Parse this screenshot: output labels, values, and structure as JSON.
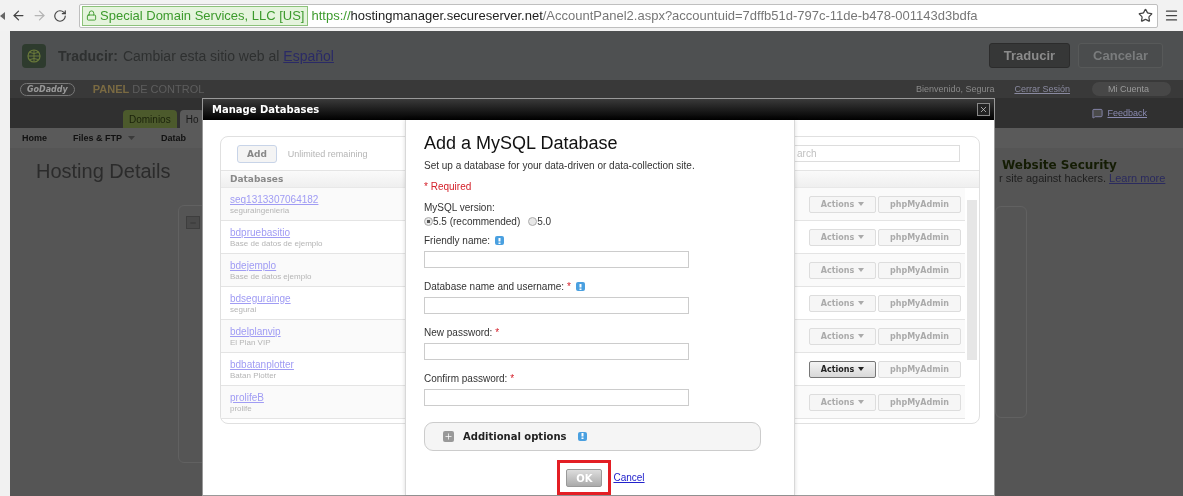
{
  "browser": {
    "security_label": "Special Domain Services, LLC [US]",
    "url_scheme": "https://",
    "url_host": "hostingmanager.secureserver.net",
    "url_path": "/AccountPanel2.aspx?accountuid=7dffb51d-797c-11de-b478-001143d3bdfa"
  },
  "translate_bar": {
    "label": "Traducir:",
    "text": "Cambiar esta sitio web al",
    "link": "Español",
    "buttons": [
      {
        "label": "Traducir",
        "disabled": false
      },
      {
        "label": "Cancelar",
        "disabled": true
      }
    ]
  },
  "header": {
    "logo": "GoDaddy",
    "title_accent": "PANEL",
    "title_rest": "DE CONTROL",
    "welcome": "Bienvenido, Segura",
    "logout": "Cerrar Sesión",
    "account": "Mi Cuenta",
    "feedback": "Feedback"
  },
  "tabs": [
    {
      "label": "Dominios",
      "selected": false
    },
    {
      "label": "Ho",
      "selected": true
    }
  ],
  "nav": [
    {
      "label": "Home",
      "dropdown": false
    },
    {
      "label": "Files & FTP",
      "dropdown": true
    },
    {
      "label": "Datab",
      "dropdown": false
    }
  ],
  "page": {
    "title": "Hosting Details",
    "promo_title": "Website Security",
    "promo_text": "r site against hackers.",
    "promo_link": "Learn more"
  },
  "modal": {
    "title": "Manage Databases",
    "add_button": "Add",
    "remaining": "Unlimited remaining",
    "search_placeholder": "arch",
    "list_header": "Databases",
    "databases": [
      {
        "name": "seq1313307064182",
        "description": "seguraingenieria",
        "actions": "Actions",
        "admin": "phpMyAdmin",
        "active": false
      },
      {
        "name": "bdpruebasitio",
        "description": "Base de datos de ejemplo",
        "actions": "Actions",
        "admin": "phpMyAdmin",
        "active": false
      },
      {
        "name": "bdejemplo",
        "description": "Base de datos ejemplo",
        "actions": "Actions",
        "admin": "phpMyAdmin",
        "active": false
      },
      {
        "name": "bdsegurainge",
        "description": "segurai",
        "actions": "Actions",
        "admin": "phpMyAdmin",
        "active": false
      },
      {
        "name": "bdelplanvip",
        "description": "El Plan VIP",
        "actions": "Actions",
        "admin": "phpMyAdmin",
        "active": false
      },
      {
        "name": "bdbatanplotter",
        "description": "Batan Plotter",
        "actions": "Actions",
        "admin": "phpMyAdmin",
        "active": true
      },
      {
        "name": "prolifeB",
        "description": "prolife",
        "actions": "Actions",
        "admin": "phpMyAdmin",
        "active": false
      }
    ]
  },
  "form": {
    "title": "Add a MySQL Database",
    "description": "Set up a database for your data-driven or data-collection site.",
    "required_note": "* Required",
    "version_label": "MySQL version:",
    "versions": [
      {
        "label": "5.5 (recommended)",
        "selected": true
      },
      {
        "label": "5.0",
        "selected": false
      }
    ],
    "fields": [
      {
        "label": "Friendly name:",
        "help": true
      },
      {
        "label": "Database name and username:",
        "mark": "*",
        "help": true
      },
      {
        "label": "New password:",
        "mark": "*",
        "help": false
      },
      {
        "label": "Confirm password:",
        "mark": "*",
        "help": false
      }
    ],
    "additional_options": {
      "label": "Additional options",
      "expanded": false,
      "help": true
    },
    "ok": "OK",
    "ok_highlighted": true,
    "cancel": "Cancel"
  }
}
